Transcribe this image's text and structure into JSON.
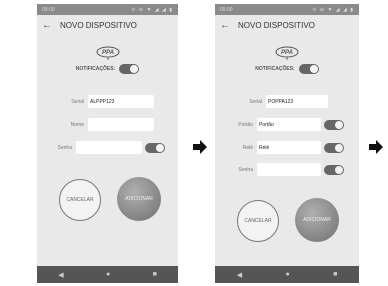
{
  "statusbar": {
    "time": "09:00",
    "icons": "⊙ ⊖ ▼ ◢ ◢ ▮"
  },
  "screen1": {
    "title": "NOVO DISPOSITIVO",
    "notifications_label": "NOTIFICAÇÕES:",
    "serial_label": "Serial",
    "serial_value": "ALPPP123",
    "nome_label": "Nome",
    "nome_value": "",
    "senha_label": "Senha",
    "senha_value": "",
    "cancel_label": "CANCELAR",
    "add_label": "ADICIONAR"
  },
  "screen2": {
    "title": "NOVO DISPOSITIVO",
    "notifications_label": "NOTIFICAÇÕES:",
    "serial_label": "Serial",
    "serial_value": "POPPA123",
    "portao_label": "Portão",
    "portao_value": "Portão",
    "rele_label": "Relé",
    "rele_value": "Relé",
    "senha_label": "Senha",
    "senha_value": "",
    "cancel_label": "CANCELAR",
    "add_label": "ADICIONAR"
  },
  "navbar": {
    "back": "◀",
    "home": "●",
    "recents": "■"
  },
  "logo_text": "PPA"
}
